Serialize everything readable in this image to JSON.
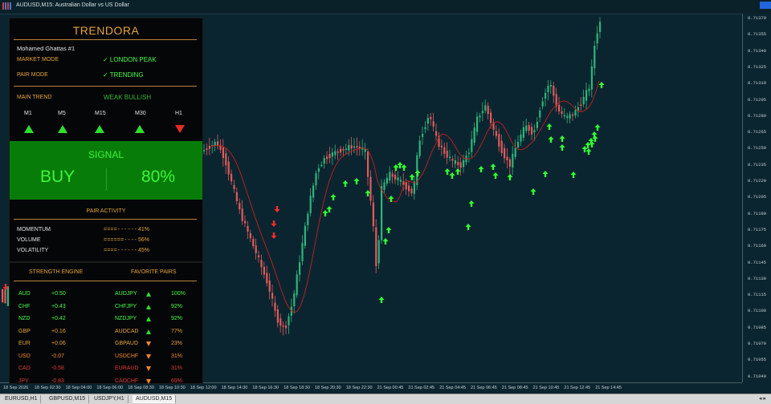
{
  "window": {
    "title": "AUDUSD,M15: Australian Dollar vs US Dollar"
  },
  "price_axis": [
    "0.71370",
    "0.71355",
    "0.71340",
    "0.71325",
    "0.71310",
    "0.71295",
    "0.71280",
    "0.71265",
    "0.71250",
    "0.71235",
    "0.71220",
    "0.71205",
    "0.71190",
    "0.71175",
    "0.71160",
    "0.71145",
    "0.71130",
    "0.71115",
    "0.71100",
    "0.71085",
    "0.71070",
    "0.71055",
    "0.71040"
  ],
  "time_axis": [
    "18 Sep 2026",
    "18 Sep 02:30",
    "18 Sep 04:00",
    "18 Sep 06:00",
    "18 Sep 08:30",
    "18 Sep 10:30",
    "18 Sep 12:00",
    "18 Sep 14:30",
    "18 Sep 16:30",
    "18 Sep 18:30",
    "18 Sep 20:30",
    "18 Sep 22:30",
    "21 Sep 00:45",
    "21 Sep 02:45",
    "21 Sep 04:45",
    "21 Sep 06:45",
    "21 Sep 08:45",
    "21 Sep 10:45",
    "21 Sep 12:45",
    "21 Sep 14:45"
  ],
  "tabs": [
    {
      "label": "EURUSD,H1",
      "active": false
    },
    {
      "label": "GBPUSD,M15",
      "active": false
    },
    {
      "label": "USDJPY,H1",
      "active": false
    },
    {
      "label": "AUDUSD,M15",
      "active": true
    }
  ],
  "dashboard": {
    "brand": "TRENDORA",
    "user": "Mohamed Ghattas #1",
    "market_mode_label": "MARKET MODE",
    "market_mode_value": "✓ LONDON PEAK",
    "pair_mode_label": "PAIR MODE",
    "pair_mode_value": "✓ TRENDING",
    "main_trend_label": "MAIN TREND",
    "main_trend_value": "WEAK BULLISH",
    "timeframes": [
      {
        "label": "M1",
        "dir": "up"
      },
      {
        "label": "M5",
        "dir": "up"
      },
      {
        "label": "M15",
        "dir": "up"
      },
      {
        "label": "M30",
        "dir": "up"
      },
      {
        "label": "H1",
        "dir": "down"
      }
    ],
    "signal_title": "SIGNAL",
    "signal_side": "BUY",
    "signal_strength": "80%",
    "activity_title": "PAIR ACTIVITY",
    "activity": [
      {
        "label": "MOMENTUM",
        "bar": "====------",
        "pct": "41%"
      },
      {
        "label": "VOLUME",
        "bar": "======----",
        "pct": "56%"
      },
      {
        "label": "VOLATILITY",
        "bar": "====------",
        "pct": "45%"
      }
    ],
    "strength_title": "STRENGTH ENGINE",
    "favorites_title": "FAVORITE PAIRS",
    "strength": [
      {
        "cur": "AUD",
        "val": "+0.50",
        "color": "#46ff46"
      },
      {
        "cur": "CHF",
        "val": "+0.43",
        "color": "#46ff46"
      },
      {
        "cur": "NZD",
        "val": "+0.42",
        "color": "#46ff46"
      },
      {
        "cur": "GBP",
        "val": "+0.16",
        "color": "#e6a53c"
      },
      {
        "cur": "EUR",
        "val": "+0.06",
        "color": "#e6a53c"
      },
      {
        "cur": "USD",
        "val": "-0.07",
        "color": "#f08a2a"
      },
      {
        "cur": "CAD",
        "val": "-0.58",
        "color": "#e03a3a"
      },
      {
        "cur": "JPY",
        "val": "-0.83",
        "color": "#e03a3a"
      }
    ],
    "favorites": [
      {
        "pair": "AUDJPY",
        "dir": "up",
        "pct": "100%",
        "color": "#46ff46"
      },
      {
        "pair": "CHFJPY",
        "dir": "up",
        "pct": "92%",
        "color": "#46ff46"
      },
      {
        "pair": "NZDJPY",
        "dir": "up",
        "pct": "92%",
        "color": "#46ff46"
      },
      {
        "pair": "AUDCAD",
        "dir": "up",
        "pct": "77%",
        "color": "#e6a53c"
      },
      {
        "pair": "GBPAUD",
        "dir": "down",
        "pct": "23%",
        "color": "#e6a53c"
      },
      {
        "pair": "USDCHF",
        "dir": "down",
        "pct": "31%",
        "color": "#f08a2a"
      },
      {
        "pair": "EURAUD",
        "dir": "down",
        "pct": "31%",
        "color": "#e03a3a"
      },
      {
        "pair": "CADCHF",
        "dir": "down",
        "pct": "69%",
        "color": "#e03a3a"
      }
    ]
  },
  "colors": {
    "bull_candle": "#2fb47a",
    "bear_candle": "#e25a5a",
    "ma_line": "#c81e1e",
    "arrow_up": "#33ff33",
    "arrow_down": "#ff2b2b",
    "chart_bg": "#0b2530",
    "panel_bg": "#050607",
    "accent": "#e6a53c",
    "signal_bg": "#087c08"
  }
}
